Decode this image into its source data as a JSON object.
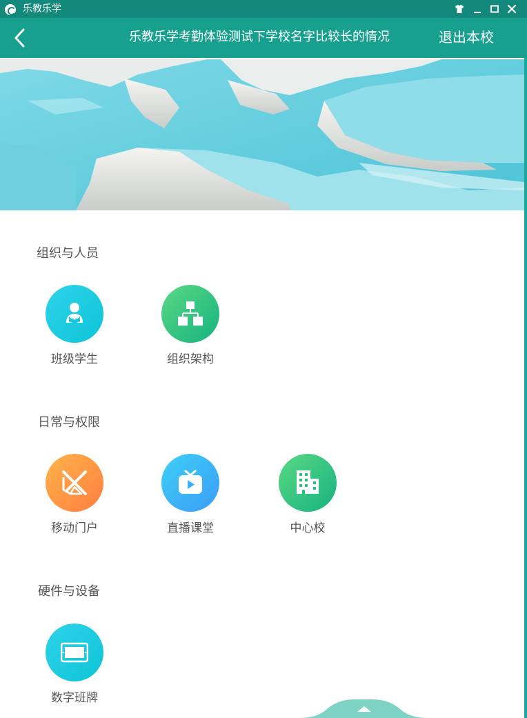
{
  "window": {
    "app_name": "乐教乐学",
    "controls": [
      "skin-icon",
      "minimize-icon",
      "maximize-icon",
      "close-icon"
    ]
  },
  "header": {
    "title": "乐教乐学考勤体验测试下学校名字比较长的情况",
    "exit_label": "退出本校"
  },
  "sections": [
    {
      "title": "组织与人员",
      "items": [
        {
          "label": "班级学生",
          "icon": "student-icon",
          "color": "#17c5da"
        },
        {
          "label": "组织架构",
          "icon": "org-chart-icon",
          "color": "#2cbf7e"
        }
      ]
    },
    {
      "title": "日常与权限",
      "items": [
        {
          "label": "移动门户",
          "icon": "mobile-portal-icon",
          "color": "#ff8a3f"
        },
        {
          "label": "直播课堂",
          "icon": "live-tv-icon",
          "color": "#3aaef6"
        },
        {
          "label": "中心校",
          "icon": "building-icon",
          "color": "#2cbf7e"
        }
      ]
    },
    {
      "title": "硬件与设备",
      "items": [
        {
          "label": "数字班牌",
          "icon": "class-board-icon",
          "color": "#17c5da"
        }
      ]
    }
  ],
  "colors": {
    "titlebar": "#13897c",
    "header": "#17a08e",
    "handle": "#7fd3c4"
  }
}
